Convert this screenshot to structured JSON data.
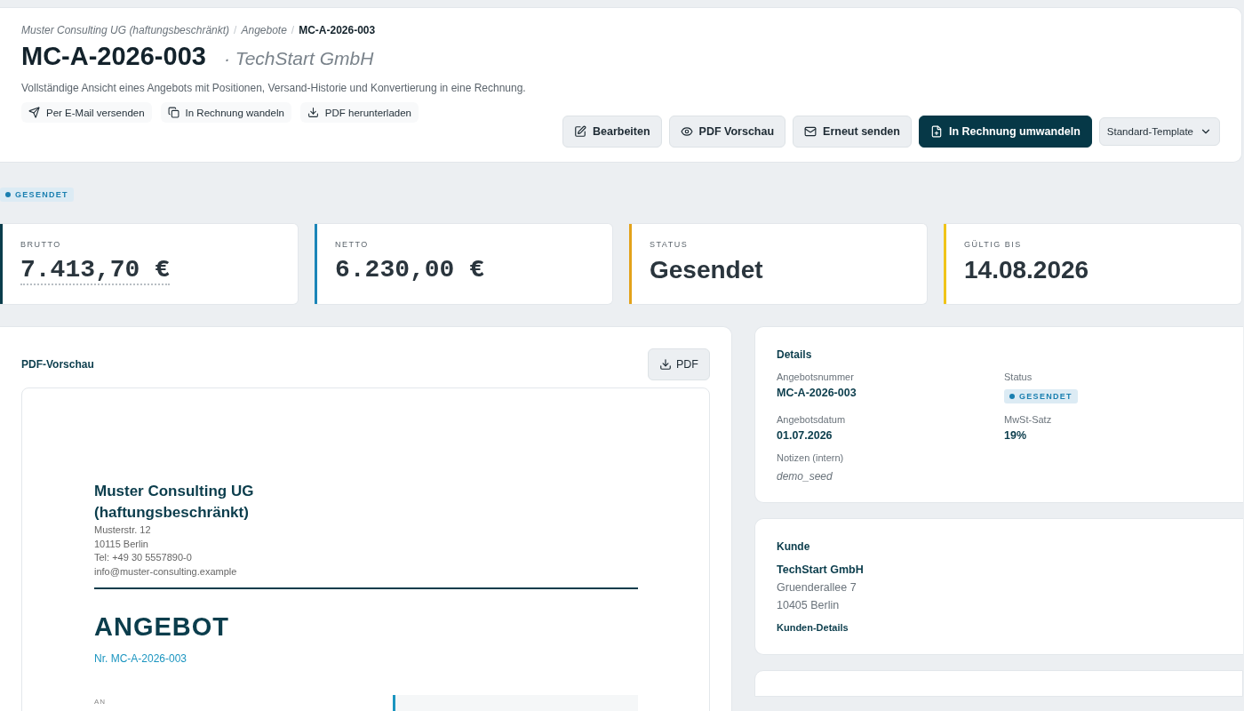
{
  "breadcrumb": [
    {
      "label": "Muster Consulting UG (haftungsbeschränkt)",
      "current": false
    },
    {
      "label": "Angebote",
      "current": false
    },
    {
      "label": "MC-A-2026-003",
      "current": true
    }
  ],
  "breadcrumb_separator": "/",
  "title": "MC-A-2026-003",
  "subtitle": "· TechStart GmbH",
  "description": "Vollständige Ansicht eines Angebots mit Positionen, Versand-Historie und Konvertierung in eine Rechnung.",
  "quick_actions": [
    {
      "label": "Per E-Mail versenden"
    },
    {
      "label": "In Rechnung wandeln"
    },
    {
      "label": "PDF herunterladen"
    }
  ],
  "actions": [
    {
      "label": "Bearbeiten",
      "kind": "secondary"
    },
    {
      "label": "PDF Vorschau",
      "kind": "secondary"
    },
    {
      "label": "Erneut senden",
      "kind": "secondary"
    },
    {
      "label": "In Rechnung umwandeln",
      "kind": "primary"
    },
    {
      "label": "Standard-Template",
      "kind": "select"
    }
  ],
  "status_badge": "GESENDET",
  "stats": [
    {
      "label": "BRUTTO",
      "value": "7.413,70 €",
      "kind": "amount",
      "dotted": true,
      "color": "#0b3d4c"
    },
    {
      "label": "NETTO",
      "value": "6.230,00 €",
      "kind": "amount",
      "dotted": false,
      "color": "#1b85b8"
    },
    {
      "label": "STATUS",
      "value": "Gesendet",
      "kind": "text",
      "dotted": false,
      "color": "#e3a21a"
    },
    {
      "label": "GÜLTIG BIS",
      "value": "14.08.2026",
      "kind": "text",
      "dotted": false,
      "color": "#f0c419"
    }
  ],
  "preview": {
    "title": "PDF-Vorschau",
    "button": "PDF",
    "document": {
      "company": "Muster Consulting UG (haftungsbeschränkt)",
      "address": [
        "Musterstr. 12",
        "10115 Berlin",
        "Tel: +49 30 5557890-0",
        "info@muster-consulting.example"
      ],
      "heading": "ANGEBOT",
      "number": "Nr. MC-A-2026-003",
      "to_label": "AN"
    }
  },
  "details": {
    "title": "Details",
    "fields": [
      {
        "label": "Angebotsnummer",
        "value": "MC-A-2026-003",
        "kind": "text"
      },
      {
        "label": "Status",
        "value": "GESENDET",
        "kind": "badge"
      },
      {
        "label": "Angebotsdatum",
        "value": "01.07.2026",
        "kind": "text"
      },
      {
        "label": "MwSt-Satz",
        "value": "19%",
        "kind": "text"
      },
      {
        "label": "Notizen (intern)",
        "value": "demo_seed",
        "kind": "note"
      }
    ]
  },
  "customer": {
    "title": "Kunde",
    "name": "TechStart GmbH",
    "address": [
      "Gruenderallee 7",
      "10405 Berlin"
    ],
    "link": "Kunden-Details"
  }
}
